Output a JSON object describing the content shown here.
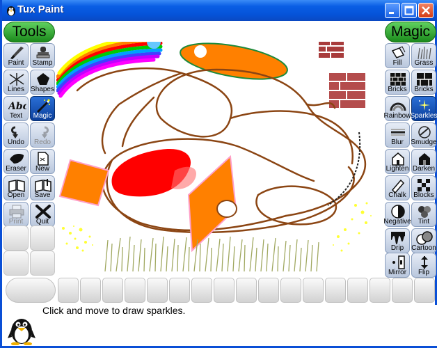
{
  "window": {
    "title": "Tux Paint"
  },
  "tools_header": "Tools",
  "magic_header": "Magic",
  "tools": [
    {
      "label": "Paint",
      "icon": "paintbrush-icon",
      "state": "normal"
    },
    {
      "label": "Stamp",
      "icon": "stamp-icon",
      "state": "normal"
    },
    {
      "label": "Lines",
      "icon": "lines-icon",
      "state": "normal"
    },
    {
      "label": "Shapes",
      "icon": "shapes-icon",
      "state": "normal"
    },
    {
      "label": "Text",
      "icon": "text-icon",
      "state": "normal"
    },
    {
      "label": "Magic",
      "icon": "magic-wand-icon",
      "state": "selected"
    },
    {
      "label": "Undo",
      "icon": "undo-icon",
      "state": "normal"
    },
    {
      "label": "Redo",
      "icon": "redo-icon",
      "state": "disabled"
    },
    {
      "label": "Eraser",
      "icon": "eraser-icon",
      "state": "normal"
    },
    {
      "label": "New",
      "icon": "new-page-icon",
      "state": "normal"
    },
    {
      "label": "Open",
      "icon": "open-book-icon",
      "state": "normal"
    },
    {
      "label": "Save",
      "icon": "save-icon",
      "state": "normal"
    },
    {
      "label": "Print",
      "icon": "printer-icon",
      "state": "disabled"
    },
    {
      "label": "Quit",
      "icon": "quit-icon",
      "state": "normal"
    }
  ],
  "magic_tools": [
    {
      "label": "Fill",
      "icon": "fill-bucket-icon",
      "state": "normal"
    },
    {
      "label": "Grass",
      "icon": "grass-icon",
      "state": "normal"
    },
    {
      "label": "Bricks",
      "icon": "bricks-small-icon",
      "state": "normal"
    },
    {
      "label": "Bricks",
      "icon": "bricks-large-icon",
      "state": "normal"
    },
    {
      "label": "Rainbow",
      "icon": "rainbow-icon",
      "state": "normal"
    },
    {
      "label": "Sparkles",
      "icon": "sparkles-icon",
      "state": "selected"
    },
    {
      "label": "Blur",
      "icon": "blur-icon",
      "state": "normal"
    },
    {
      "label": "Smudge",
      "icon": "smudge-icon",
      "state": "normal"
    },
    {
      "label": "Lighten",
      "icon": "lighten-icon",
      "state": "normal"
    },
    {
      "label": "Darken",
      "icon": "darken-icon",
      "state": "normal"
    },
    {
      "label": "Chalk",
      "icon": "chalk-icon",
      "state": "normal"
    },
    {
      "label": "Blocks",
      "icon": "blocks-icon",
      "state": "normal"
    },
    {
      "label": "Negative",
      "icon": "negative-icon",
      "state": "normal"
    },
    {
      "label": "Tint",
      "icon": "tint-icon",
      "state": "normal"
    },
    {
      "label": "Drip",
      "icon": "drip-icon",
      "state": "normal"
    },
    {
      "label": "Cartoon",
      "icon": "cartoon-icon",
      "state": "normal"
    },
    {
      "label": "Mirror",
      "icon": "mirror-icon",
      "state": "normal"
    },
    {
      "label": "Flip",
      "icon": "flip-icon",
      "state": "normal"
    }
  ],
  "status_message": "Click and move to draw sparkles.",
  "colors": {
    "title_bar": "#0a5fe5",
    "selected_tool": "#1b55c0",
    "header_green": "#33a833",
    "orange": "#ff8000",
    "red": "#ff0000",
    "brown": "#8b4513",
    "brick": "#a83c3c",
    "grass": "#99aa55",
    "sparkle": "#ffff33"
  }
}
